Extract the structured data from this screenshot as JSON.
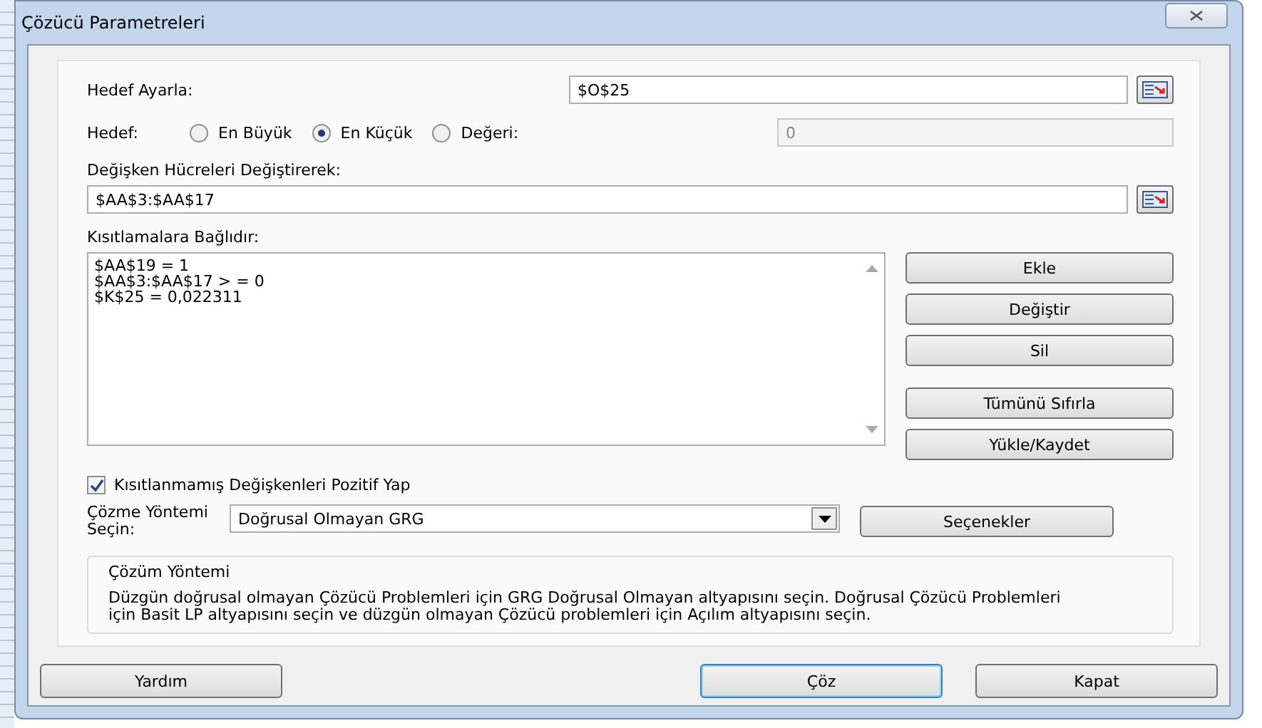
{
  "window": {
    "title": "Çözücü Parametreleri"
  },
  "set_objective": {
    "label": "Hedef Ayarla:",
    "value": "$O$25"
  },
  "objective": {
    "label": "Hedef:",
    "options": [
      {
        "label": "En Büyük",
        "selected": false
      },
      {
        "label": "En Küçük",
        "selected": true
      },
      {
        "label": "Değeri:",
        "selected": false
      }
    ],
    "value_field": {
      "value": "0",
      "disabled": true
    }
  },
  "changing_cells": {
    "label": "Değişken Hücreleri Değiştirerek:",
    "value": "$AA$3:$AA$17"
  },
  "constraints": {
    "label": "Kısıtlamalara Bağlıdır:",
    "items": [
      "$AA$19 = 1",
      "$AA$3:$AA$17 > = 0",
      "$K$25 = 0,022311"
    ]
  },
  "constraint_buttons": [
    {
      "label": "Ekle"
    },
    {
      "label": "Değiştir"
    },
    {
      "label": "Sil"
    },
    {
      "label": "Tümünü Sıfırla"
    },
    {
      "label": "Yükle/Kaydet"
    }
  ],
  "nonnegative": {
    "label": "Kısıtlanmamış Değişkenleri Pozitif Yap",
    "checked": true
  },
  "method": {
    "label": "Çözme Yöntemi Seçin:",
    "value": "Doğrusal Olmayan GRG",
    "options_button": "Seçenekler"
  },
  "description": {
    "title": "Çözüm Yöntemi",
    "text": "Düzgün doğrusal olmayan Çözücü Problemleri için GRG Doğrusal Olmayan altyapısını seçin. Doğrusal Çözücü Problemleri için Basit LP altyapısını seçin ve düzgün olmayan Çözücü problemleri için Açılım altyapısını seçin."
  },
  "footer_buttons": [
    {
      "label": "Yardım",
      "default": false
    },
    {
      "label": "Çöz",
      "default": true
    },
    {
      "label": "Kapat",
      "default": false
    }
  ]
}
